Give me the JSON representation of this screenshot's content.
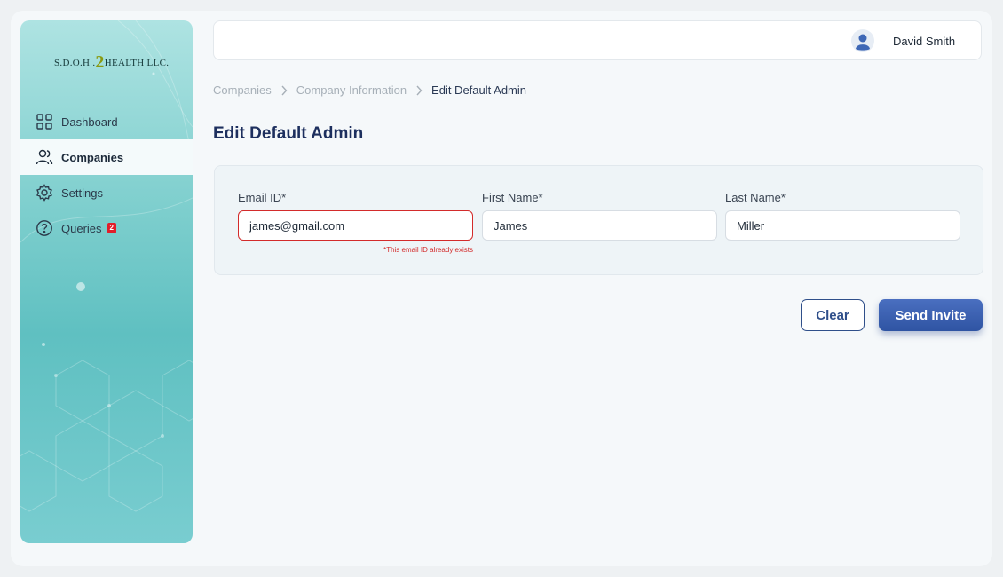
{
  "app": {
    "logo_prefix": "S.D.O.H .",
    "logo_two": "2",
    "logo_suffix": "HEALTH LLC."
  },
  "sidebar": {
    "items": [
      {
        "label": "Dashboard",
        "icon": "grid-icon"
      },
      {
        "label": "Companies",
        "icon": "users-icon",
        "active": true
      },
      {
        "label": "Settings",
        "icon": "gear-icon"
      },
      {
        "label": "Queries",
        "icon": "question-circle-icon",
        "badge": "2"
      }
    ]
  },
  "header": {
    "user_name": "David Smith",
    "avatar_icon": "user-avatar-icon"
  },
  "breadcrumb": {
    "items": [
      "Companies",
      "Company Information",
      "Edit Default Admin"
    ]
  },
  "page": {
    "title": "Edit Default Admin"
  },
  "form": {
    "email": {
      "label": "Email ID*",
      "value": "james@gmail.com",
      "error": "*This email ID already exists"
    },
    "first_name": {
      "label": "First Name*",
      "value": "James"
    },
    "last_name": {
      "label": "Last Name*",
      "value": "Miller"
    }
  },
  "actions": {
    "clear_label": "Clear",
    "send_label": "Send Invite"
  },
  "colors": {
    "accent": "#2f54a3",
    "title": "#1d2f5e",
    "error": "#d32b2b",
    "badge": "#e11d2a"
  }
}
